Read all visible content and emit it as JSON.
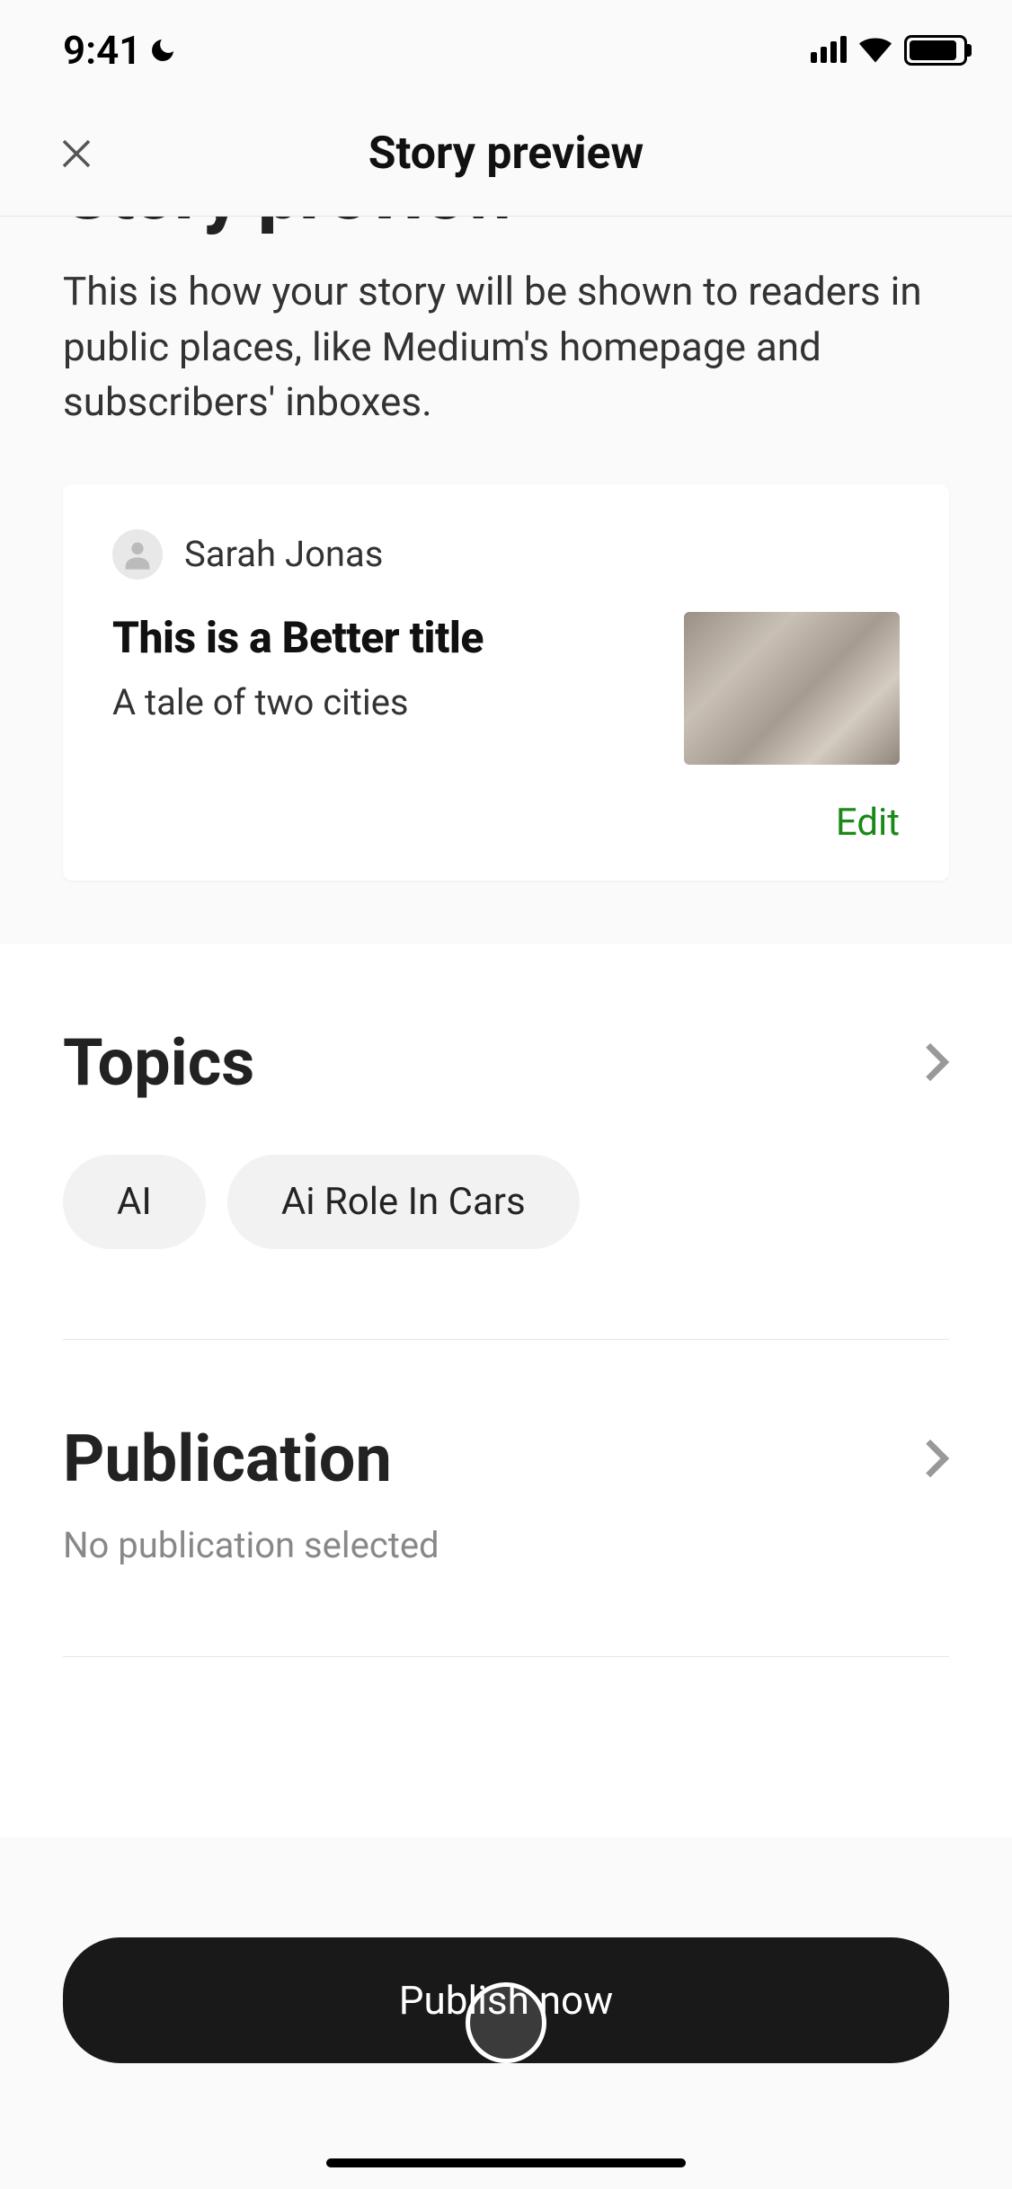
{
  "status": {
    "time": "9:41"
  },
  "nav": {
    "title": "Story preview"
  },
  "page": {
    "heading": "Story preview",
    "description": "This is how your story will be shown to readers in public places, like Medium's homepage and subscribers' inboxes."
  },
  "preview": {
    "author": "Sarah Jonas",
    "title": "This is a Better title",
    "subtitle": "A tale of two cities",
    "edit_label": "Edit"
  },
  "topics": {
    "heading": "Topics",
    "chips": [
      "AI",
      "Ai Role In Cars"
    ]
  },
  "publication": {
    "heading": "Publication",
    "status": "No publication selected"
  },
  "actions": {
    "publish": "Publish now"
  }
}
